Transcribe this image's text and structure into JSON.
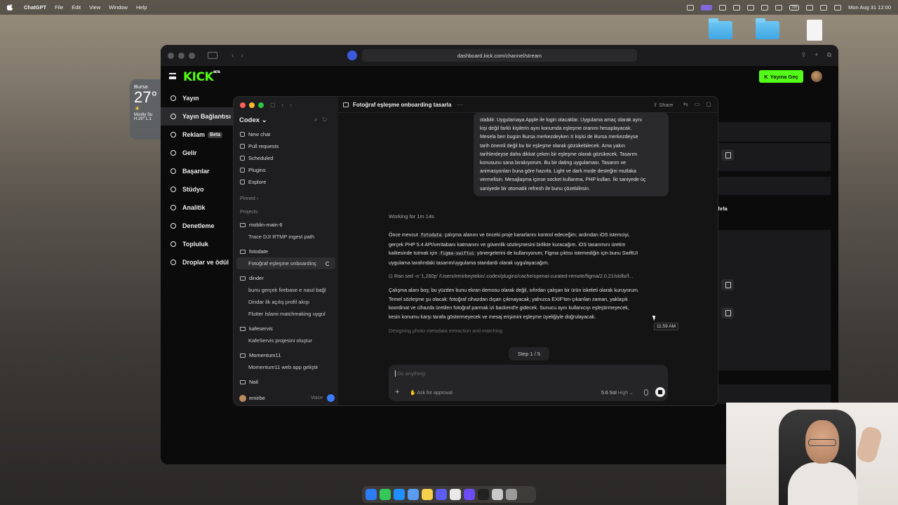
{
  "menubar": {
    "app": "ChatGPT",
    "menus": [
      "File",
      "Edit",
      "View",
      "Window",
      "Help"
    ],
    "keyboard_badge": "TR",
    "clock": "Mon Aug 31  12:00"
  },
  "weather": {
    "city": "Bursa",
    "temp": "27°",
    "desc": "Mostly Su",
    "hilo": "H:29° L:1"
  },
  "browser": {
    "url": "dashboard.kick.com/channel/stream"
  },
  "kick": {
    "logo": "KICK",
    "logo_beta": "BETA",
    "go_live": "Yayına Geç",
    "nav": [
      "Yayın",
      "Yayın Bağlantısı",
      "Reklam",
      "Gelir",
      "Başarılar",
      "Stüdyo",
      "Analitik",
      "Denetleme",
      "Topluluk",
      "Droplar ve ödül"
    ],
    "beta_badge": "Beta",
    "side_text": "ıfırla"
  },
  "codex": {
    "brand": "Codex",
    "top_items": [
      "New chat",
      "Pull requests",
      "Scheduled",
      "Plugins",
      "Explore"
    ],
    "pinned_label": "Pinned",
    "projects_label": "Projects",
    "projects": [
      {
        "name": "moblin-main-6",
        "chats": [
          "Trace DJI RTMP ingest path"
        ]
      },
      {
        "name": "fotodate",
        "chats": [
          "Fotoğraf eşleşme onboardinç"
        ]
      },
      {
        "name": "dinder",
        "chats": [
          "bunu gerçek firebase e nasıl bağl",
          "Dindar ilk açılış profil akışı",
          "Flutter İslami matchmaking uygul"
        ]
      },
      {
        "name": "kafeservis",
        "chats": [
          "KafeServis projesini oluştur"
        ]
      },
      {
        "name": "Momentum11",
        "chats": [
          "Momentum11 web app geliştir"
        ]
      },
      {
        "name": "Nail",
        "chats": []
      }
    ],
    "user": "emirbe",
    "voice": "Voice",
    "header_title": "Fotoğraf eşleşme onboarding tasarla",
    "share": "Share",
    "user_message_lines": [
      "olabilir. Uygulamaya Apple ile login olacaklar. Uygulama amaç olarak aynı",
      "kişi değil farklı kişilerin aynı konumda eşleşme oranını hesaplayacak.",
      "Mesela ben bugün Bursa merkezdeyken X kişisi de Bursa merkezdeyse",
      "tarih önemli değil bu bir eşleşme olarak gözükebilecek. Ama yakın",
      "tarihlerdeyse daha dikkat çeken bir eşleşme olarak gözükecek. Tasarım",
      "konusunu sana bırakıyorum. Bu bir dating uygulaması. Tasarım ve",
      "animasyonları buna göre hazırla. Light ve dark mode desteğini mutlaka",
      "vermelisin. Mesajlaşma içinse socket kullanma, PHP kullan. İki saniyede üç",
      "saniyede bir otomatik refresh ile bunu çözebilirsin."
    ],
    "working": "Working for 1m 14s",
    "para1": {
      "a": "Önce mevcut ",
      "code1": "fotodate",
      "b": " çalışma alanını ve önceki proje kararlarını kontrol edeceğim; ardından iOS istemciyi,",
      "line2": "gerçek PHP 5.4 API/veritabanı katmanını ve güvenlik sözleşmesini birlikte kuracağım. iOS tasarımını üretim",
      "c": "kalitesinde tutmak için ",
      "code2": "figma-swiftui",
      "d": " yönergelerini de kullanıyorum; Figma çıktısı istemediğin için bunu SwiftUI",
      "line4": "uygulama tarafındaki tasarım/uygulama standardı olarak uygulayacağım."
    },
    "ran_line": "Ran sed -n '1,260p' /Users/emirbeytekin/.codex/plugins/cache/openai-curated-remote/figma/2.0.21/skills/f...",
    "para2_lines": [
      "Çalışma alanı boş; bu yüzden bunu ekran demosu olarak değil, sıfırdan çalışan bir ürün iskeleti olarak kuruyorum.",
      "Temel sözleşme şu olacak: fotoğraf cihazdan dışarı çıkmayacak; yalnızca EXIF'ten çıkarılan zaman, yaklaşık",
      "koordinat ve cihazda üretilen fotoğraf parmak izi backend'e gidecek. Sunucu aynı kullanıcıyı eşleştirmeyecek,",
      "kesin konumu karşı tarafa göstermeyecek ve mesaj erişimini eşleşme üyeliğiyle doğrulayacak."
    ],
    "thinking": "Designing photo metadata extraction and matching",
    "step": "Step 1 / 5",
    "composer_placeholder": "Do anything",
    "approval": "Ask for approval",
    "model": "5.6 Sol",
    "effort": "High",
    "tooltip": "11:59 AM"
  },
  "colors": {
    "kick_green": "#53fc18",
    "codex_bg": "#141414",
    "sidebar_bg": "#1e1e20"
  }
}
